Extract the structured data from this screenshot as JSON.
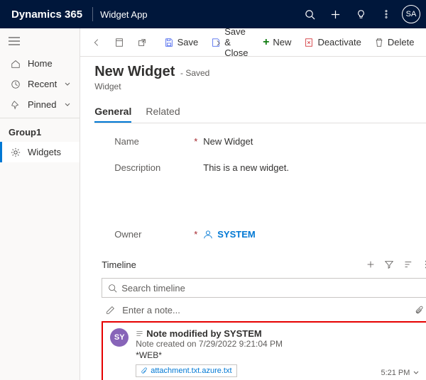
{
  "topbar": {
    "brand": "Dynamics 365",
    "app": "Widget App",
    "avatar": "SA"
  },
  "sidebar": {
    "home": "Home",
    "recent": "Recent",
    "pinned": "Pinned",
    "group": "Group1",
    "widgets": "Widgets"
  },
  "commands": {
    "save": "Save",
    "save_close": "Save & Close",
    "new": "New",
    "deactivate": "Deactivate",
    "delete": "Delete"
  },
  "header": {
    "title": "New Widget",
    "status": "- Saved",
    "entity": "Widget"
  },
  "tabs": {
    "general": "General",
    "related": "Related"
  },
  "form": {
    "name_label": "Name",
    "name_value": "New Widget",
    "desc_label": "Description",
    "desc_value": "This is a new widget.",
    "owner_label": "Owner",
    "owner_value": "SYSTEM"
  },
  "timeline": {
    "label": "Timeline",
    "search_placeholder": "Search timeline",
    "enter_note": "Enter a note...",
    "card": {
      "avatar": "SY",
      "title": "Note modified by SYSTEM",
      "created": "Note created on 7/29/2022 9:21:04 PM",
      "tag": "*WEB*",
      "attachment": "attachment.txt.azure.txt",
      "time": "5:21 PM"
    }
  }
}
